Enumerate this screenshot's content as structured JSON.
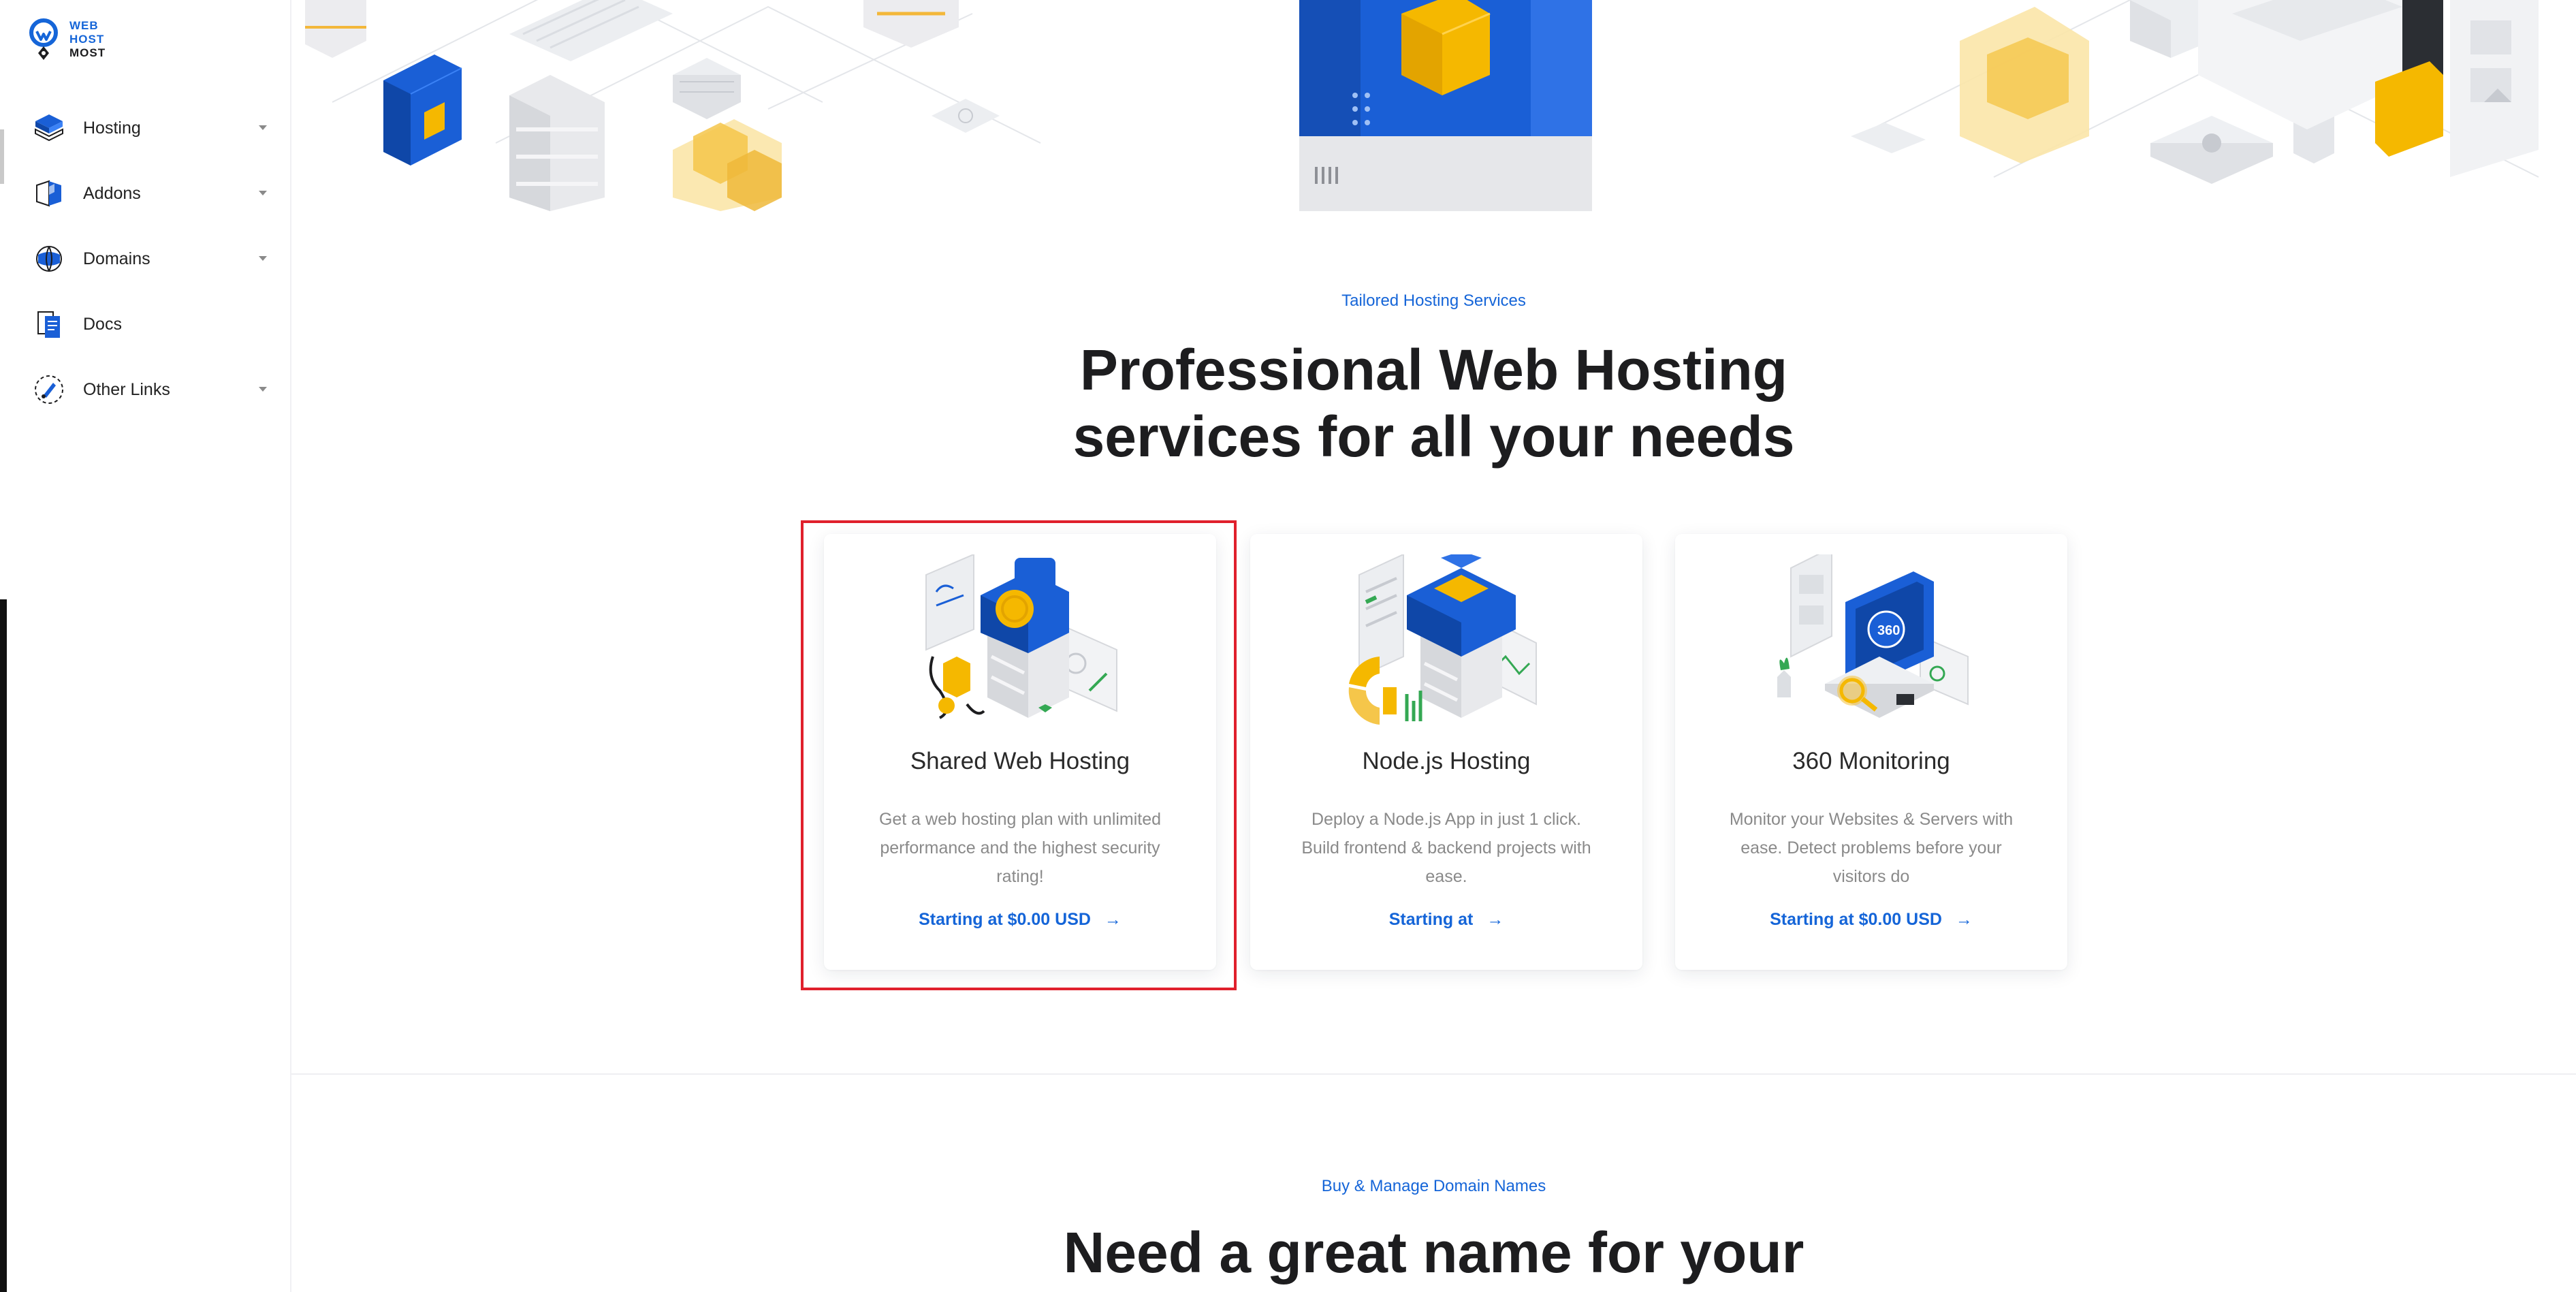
{
  "logo": {
    "line1": "WEB",
    "line2": "HOST",
    "line3": "MOST"
  },
  "sidebar": {
    "items": [
      {
        "label": "Hosting",
        "icon": "hosting-icon",
        "has_dropdown": true
      },
      {
        "label": "Addons",
        "icon": "addons-icon",
        "has_dropdown": true
      },
      {
        "label": "Domains",
        "icon": "domains-icon",
        "has_dropdown": true
      },
      {
        "label": "Docs",
        "icon": "docs-icon",
        "has_dropdown": false
      },
      {
        "label": "Other Links",
        "icon": "other-links-icon",
        "has_dropdown": true
      }
    ]
  },
  "hosting_section": {
    "eyebrow": "Tailored Hosting Services",
    "headline_line1": "Professional Web Hosting",
    "headline_line2": "services for all your needs"
  },
  "cards": [
    {
      "title": "Shared Web Hosting",
      "description": "Get a web hosting plan with unlimited performance and the highest security rating!",
      "link": "Starting at $0.00 USD",
      "highlighted": true
    },
    {
      "title": "Node.js Hosting",
      "description": "Deploy a Node.js App in just 1 click. Build frontend & backend projects with ease.",
      "link": "Starting at",
      "highlighted": false
    },
    {
      "title": "360 Monitoring",
      "description": "Monitor your Websites & Servers with ease. Detect problems before your visitors do",
      "link": "Starting at $0.00 USD",
      "highlighted": false
    }
  ],
  "domain_section": {
    "eyebrow": "Buy & Manage Domain Names",
    "headline": "Need a great name for your"
  },
  "colors": {
    "accent": "#1565d8",
    "highlight": "#e0202c",
    "illustration_yellow": "#f5b800",
    "illustration_blue": "#1a5fd6"
  },
  "arrow_glyph": "→"
}
